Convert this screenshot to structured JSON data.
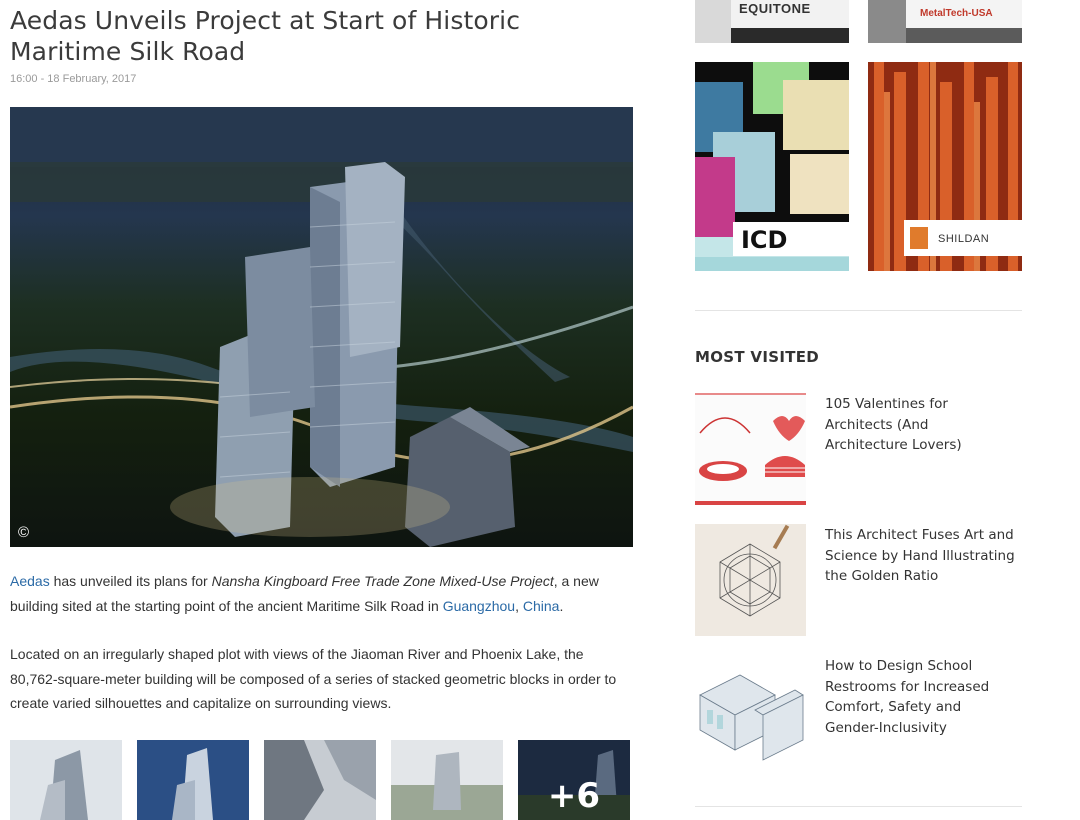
{
  "article": {
    "title": "Aedas Unveils Project at Start of Historic Maritime Silk Road",
    "date": "16:00 - 18 February, 2017",
    "hero_copyright": "©",
    "paragraph1": {
      "link_aedas": "Aedas",
      "text_a": " has unveiled its plans for ",
      "project_name": "Nansha Kingboard Free Trade Zone Mixed-Use Project",
      "text_b": ", a new building sited at the starting point of the ancient Maritime Silk Road in ",
      "link_guangzhou": "Guangzhou",
      "sep": ", ",
      "link_china": "China",
      "end": "."
    },
    "paragraph2": "Located on an irregularly shaped plot with views of the Jiaoman River and Phoenix Lake, the 80,762-square-meter building will be composed of a series of stacked geometric blocks in order to create varied silhouettes and capitalize on surrounding views.",
    "gallery_more": "+6"
  },
  "sidebar": {
    "ads": [
      {
        "brand": "EQUITONE"
      },
      {
        "brand": "MetalTech-USA"
      },
      {
        "brand": "ICD"
      },
      {
        "brand": "SHILDAN"
      }
    ],
    "most_visited_title": "MOST VISITED",
    "most_visited": [
      {
        "title": "105 Valentines for Architects (And Architecture Lovers)"
      },
      {
        "title": "This Architect Fuses Art and Science by Hand Illustrating the Golden Ratio"
      },
      {
        "title": "How to Design School Restrooms for Increased Comfort, Safety and Gender-Inclusivity"
      }
    ]
  },
  "colors": {
    "link": "#2b6aa6",
    "text": "#333333",
    "date": "#9a9a9a",
    "divider": "#e4e4e4"
  }
}
